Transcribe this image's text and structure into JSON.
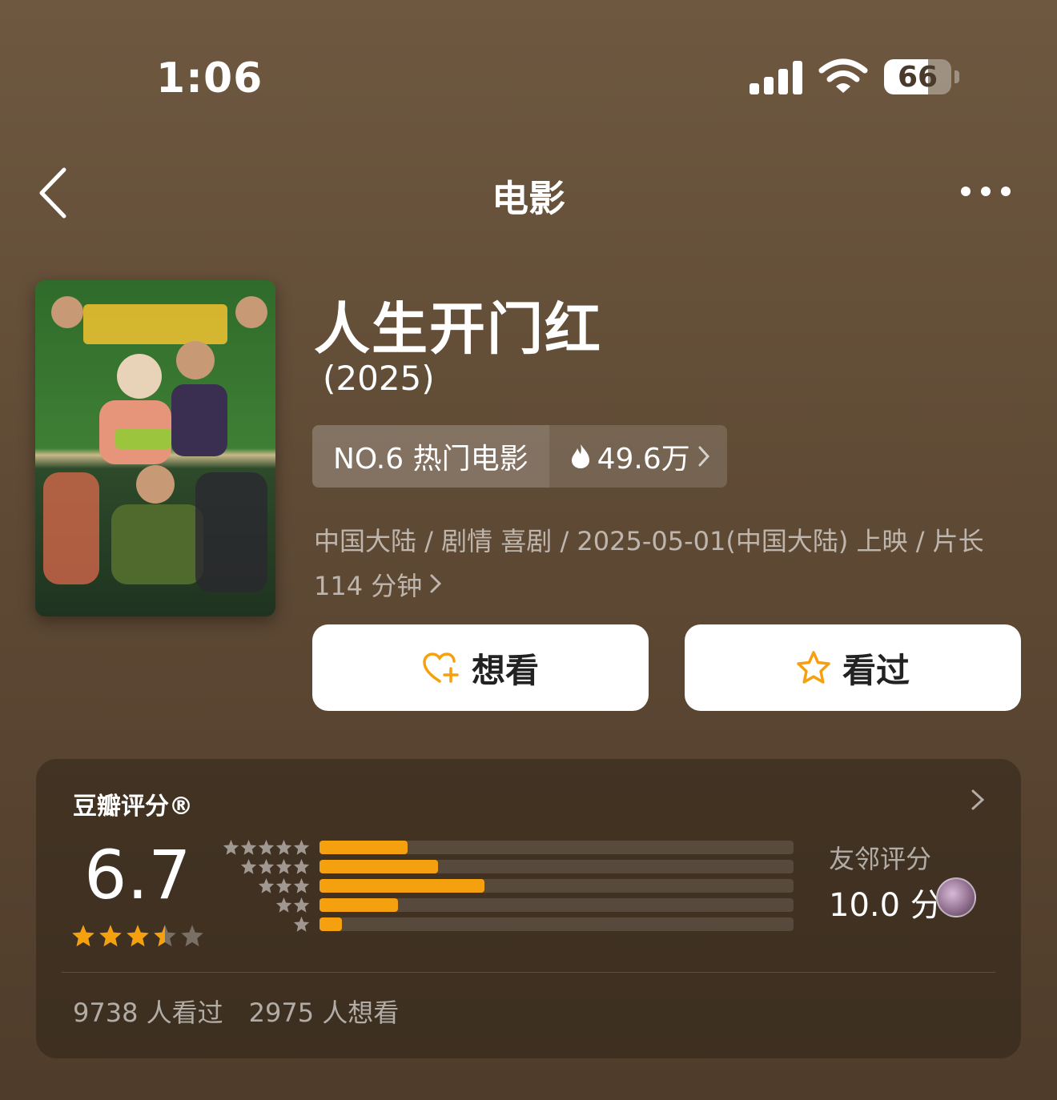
{
  "status_bar": {
    "time": "1:06",
    "battery": "66",
    "battery_level": 0.66
  },
  "nav": {
    "title": "电影"
  },
  "movie": {
    "title": "人生开门红",
    "year": "(2025)",
    "rank_label": "NO.6 热门电影",
    "heat": "49.6万",
    "meta": "中国大陆 / 剧情 喜剧 / 2025-05-01(中国大陆) 上映 / 片长 114 分钟"
  },
  "actions": {
    "want_label": "想看",
    "watched_label": "看过"
  },
  "rating": {
    "title": "豆瓣评分®",
    "score": "6.7",
    "stars": 3.5,
    "distribution": [
      {
        "stars": 5,
        "fraction": 0.186
      },
      {
        "stars": 4,
        "fraction": 0.25
      },
      {
        "stars": 3,
        "fraction": 0.348
      },
      {
        "stars": 2,
        "fraction": 0.166
      },
      {
        "stars": 1,
        "fraction": 0.047
      }
    ],
    "friend_label": "友邻评分",
    "friend_score": "10.0 分",
    "watched_count": "9738 人看过",
    "want_count": "2975 人想看"
  },
  "colors": {
    "accent": "#f5a10f",
    "background": "#6e5840"
  }
}
